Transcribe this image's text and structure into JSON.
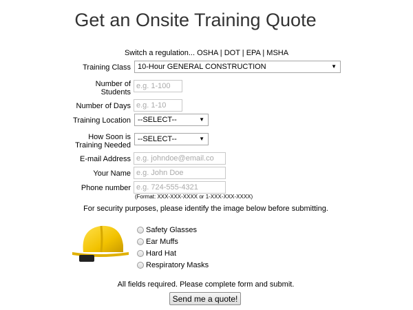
{
  "title": "Get an Onsite Training Quote",
  "switch": {
    "prefix": "Switch a regulation...",
    "links": [
      "OSHA",
      "DOT",
      "EPA",
      "MSHA"
    ],
    "separator": "|"
  },
  "form": {
    "training_class": {
      "label": "Training Class",
      "value": "10-Hour GENERAL CONSTRUCTION"
    },
    "num_students": {
      "label_line1": "Number of",
      "label_line2": "Students",
      "placeholder": "e.g. 1-100"
    },
    "num_days": {
      "label": "Number of Days",
      "placeholder": "e.g. 1-10"
    },
    "location": {
      "label": "Training Location",
      "value": "--SELECT--"
    },
    "how_soon": {
      "label_line1": "How Soon is",
      "label_line2": "Training Needed",
      "value": "--SELECT--"
    },
    "email": {
      "label": "E-mail Address",
      "placeholder": "e.g. johndoe@email.co"
    },
    "name": {
      "label": "Your Name",
      "placeholder": "e.g. John Doe"
    },
    "phone": {
      "label": "Phone number",
      "placeholder": "e.g. 724-555-4321",
      "format": "(Format: XXX-XXX-XXXX or 1-XXX-XXX-XXXX)"
    }
  },
  "security_text": "For security purposes, please identify the image below before submitting.",
  "captcha_image": "hard-hat-icon",
  "captcha_options": [
    "Safety Glasses",
    "Ear Muffs",
    "Hard Hat",
    "Respiratory Masks"
  ],
  "required_text": "All fields required. Please complete form and submit.",
  "submit_label": "Send me a quote!",
  "colors": {
    "helmet": "#f2c200",
    "title": "#333333"
  }
}
